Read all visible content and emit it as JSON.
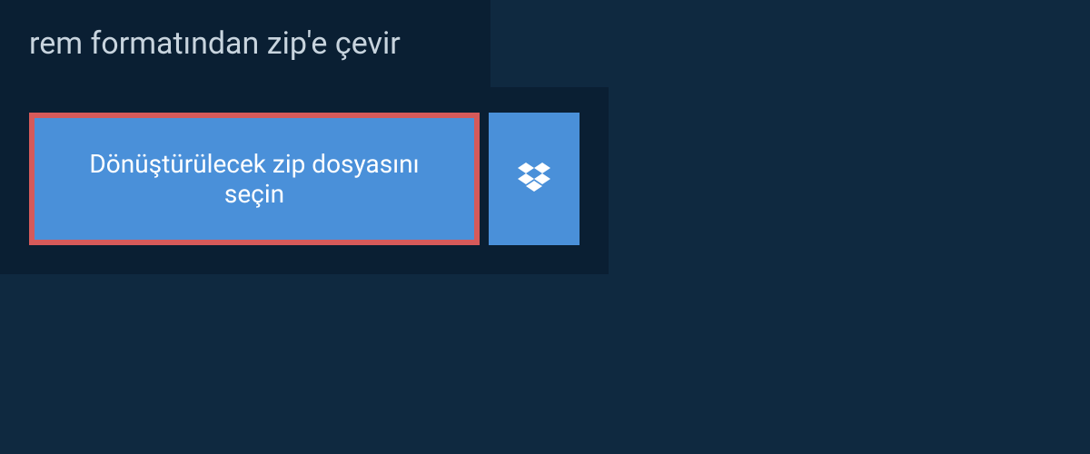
{
  "header": {
    "title": "rem formatından zip'e çevir"
  },
  "actions": {
    "select_file_label": "Dönüştürülecek zip dosyasını seçin",
    "dropbox_icon_name": "dropbox"
  },
  "colors": {
    "background": "#0f2940",
    "panel": "#0a1f33",
    "button": "#4a90d9",
    "button_border": "#d65a5a",
    "text_light": "#c8d4de",
    "text_white": "#ffffff"
  }
}
